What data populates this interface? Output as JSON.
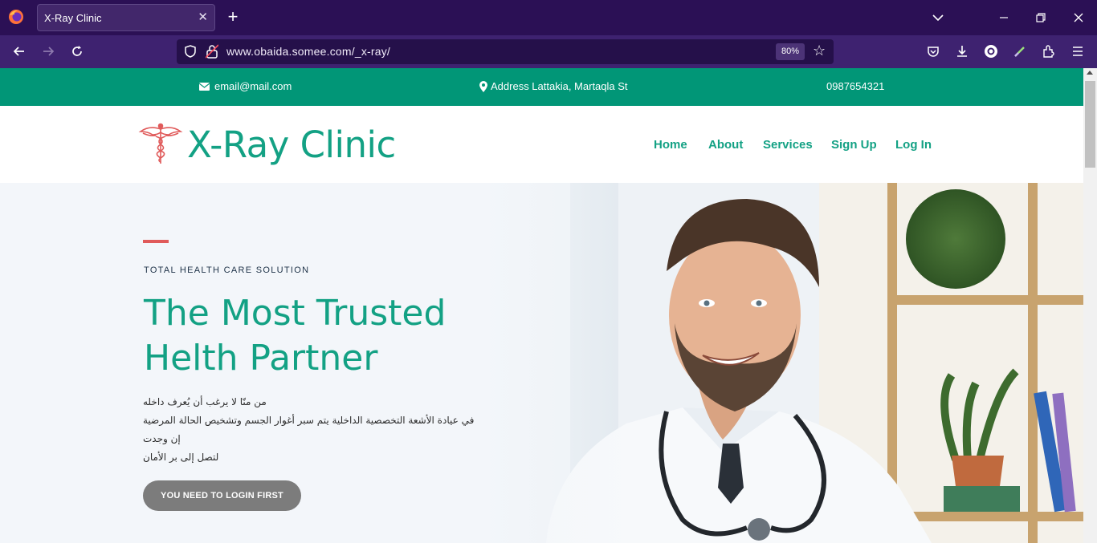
{
  "browser": {
    "tab_title": "X-Ray Clinic",
    "new_tab_label": "+",
    "close_tab_label": "✕",
    "url": "www.obaida.somee.com/_x-ray/",
    "zoom": "80%",
    "window_controls": [
      "minimize",
      "restore",
      "close"
    ]
  },
  "topbar": {
    "email": "email@mail.com",
    "address": "Address Lattakia, Martaqla St",
    "phone": "0987654321",
    "background": "#019677"
  },
  "header": {
    "logo_text": "X-Ray Clinic",
    "nav": [
      "Home",
      "About",
      "Services",
      "Sign Up",
      "Log In"
    ],
    "accent": "#13a184",
    "logo_icon_color": "#e05a5a"
  },
  "hero": {
    "kicker": "TOTAL HEALTH CARE SOLUTION",
    "title_line1": "The Most Trusted",
    "title_line2": "Helth Partner",
    "desc_line1": "من منّا لا يرغب أن يُعرف داخله",
    "desc_line2": "في عيادة الأشعة التخصصية الداخلية يتم سبر أغوار الجسم وتشخيص الحالة المرضية إن وجدت",
    "desc_line3": "لتصل إلى بر الأمان",
    "cta_label": "YOU NEED TO LOGIN FIRST",
    "accent_line_color": "#e05a5a"
  }
}
